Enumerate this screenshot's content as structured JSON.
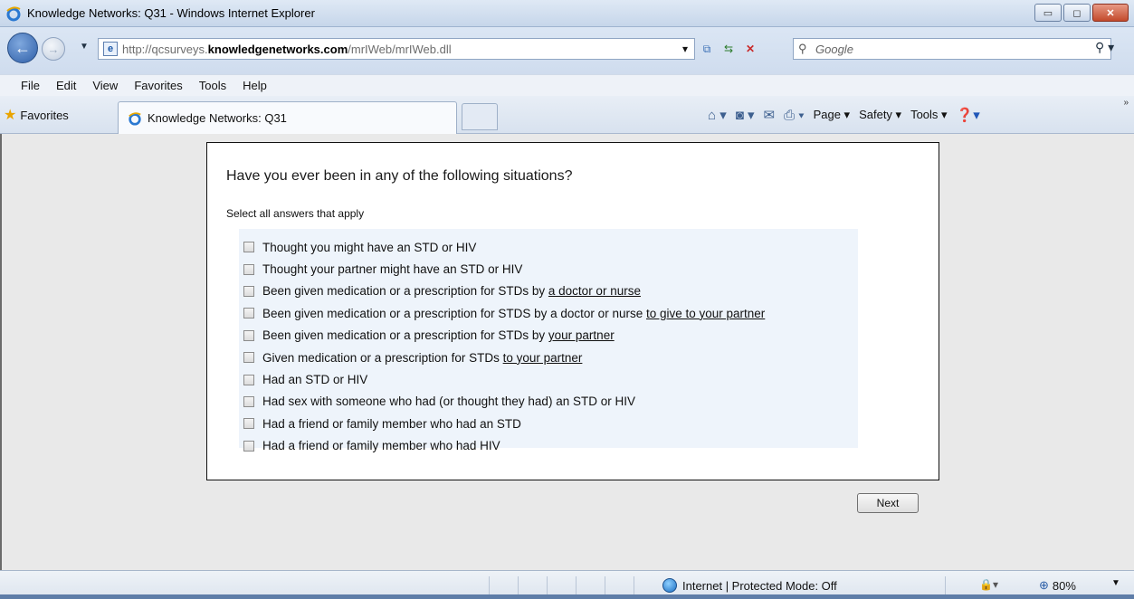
{
  "window": {
    "title": "Knowledge Networks: Q31 - Windows Internet Explorer",
    "buttons": {
      "minimize": "▭",
      "maximize": "◻",
      "close": "✕"
    }
  },
  "address": {
    "url_prefix": "http://qcsurveys.",
    "url_host": "knowledgenetworks.com",
    "url_path": "/mrIWeb/mrIWeb.dll",
    "search_placeholder": "Google"
  },
  "menu": {
    "items": [
      "File",
      "Edit",
      "View",
      "Favorites",
      "Tools",
      "Help"
    ]
  },
  "tabs": {
    "favorites_label": "Favorites",
    "active_tab": "Knowledge Networks: Q31"
  },
  "commandbar": {
    "page": "Page ▾",
    "safety": "Safety ▾",
    "tools": "Tools ▾"
  },
  "survey": {
    "question": "Have you ever been in any of the following situations?",
    "instruction": "Select all answers that apply",
    "answers": [
      {
        "text": "Thought you might have an STD or HIV",
        "underlined": ""
      },
      {
        "text": "Thought your partner might have an STD or HIV",
        "underlined": ""
      },
      {
        "text": "Been given medication or a prescription for STDs by ",
        "underlined": "a doctor or nurse"
      },
      {
        "text": "Been given medication or a prescription for STDS by a doctor or nurse ",
        "underlined": "to give to your partner"
      },
      {
        "text": "Been given medication or a prescription for STDs by ",
        "underlined": "your partner"
      },
      {
        "text": "Given medication or a prescription for STDs ",
        "underlined": "to your partner"
      },
      {
        "text": "Had an STD or HIV",
        "underlined": ""
      },
      {
        "text": "Had sex with someone who had (or thought they had) an STD or HIV",
        "underlined": ""
      },
      {
        "text": "Had a friend or family member who had an STD",
        "underlined": ""
      },
      {
        "text": "Had a friend or family member who had HIV",
        "underlined": ""
      }
    ],
    "next_label": "Next"
  },
  "status": {
    "zone": "Internet | Protected Mode: Off",
    "zoom": "80%"
  }
}
